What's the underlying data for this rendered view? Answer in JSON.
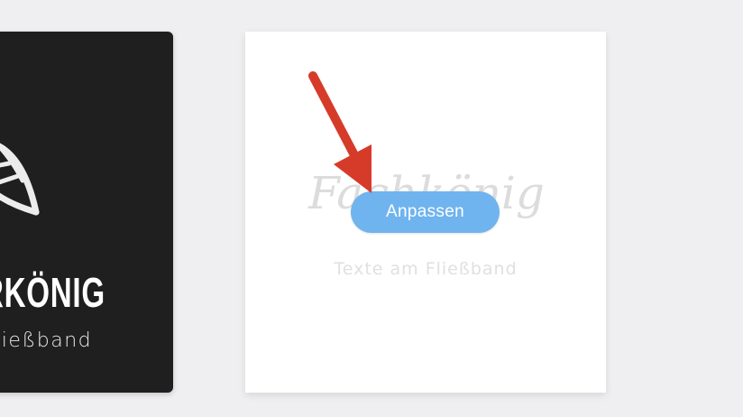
{
  "cards": {
    "dark": {
      "brand_text": "RKÖNIG",
      "tagline": "Fließband",
      "icon": "leaf-icon"
    },
    "light": {
      "script_text": "Fachkönig",
      "subtitle": "Texte am Fließband"
    }
  },
  "actions": {
    "customize_label": "Anpassen"
  },
  "annotation": {
    "icon": "arrow-pointer-icon",
    "color": "#d63b2a"
  },
  "colors": {
    "background": "#efeff1",
    "dark_card": "#1f1f1f",
    "button": "#6fb4ef"
  }
}
